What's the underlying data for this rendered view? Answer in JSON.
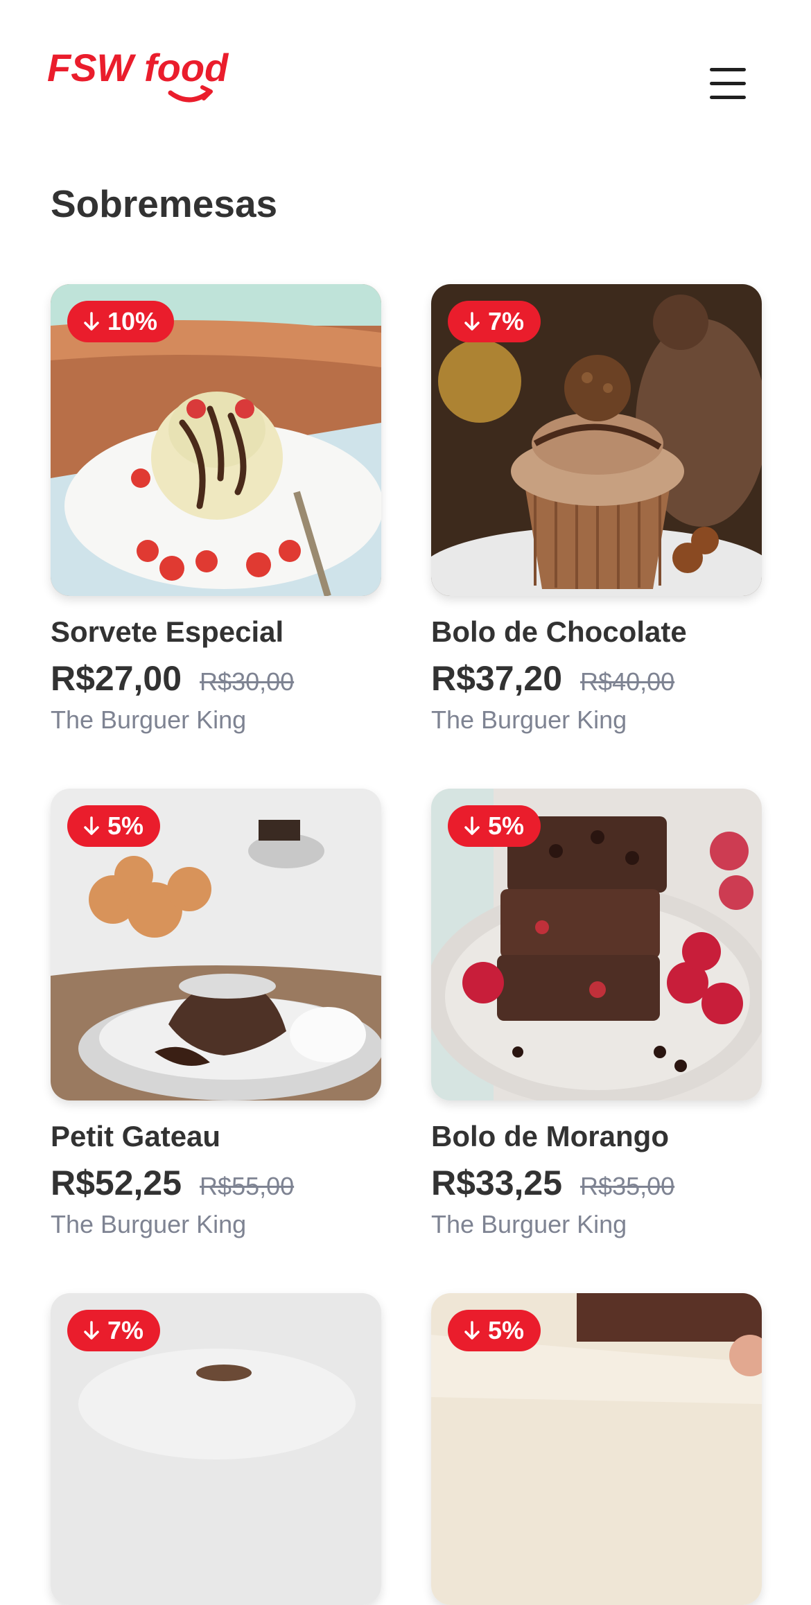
{
  "app": {
    "logo_text": "FSW food"
  },
  "page": {
    "title": "Sobremesas"
  },
  "colors": {
    "brand": "#EA1D2C",
    "text": "#323232",
    "muted": "#7E8392"
  },
  "icons": {
    "menu": "hamburger-menu-icon",
    "discount": "arrow-down-icon"
  },
  "products": [
    {
      "name": "Sorvete Especial",
      "price": "R$27,00",
      "old_price": "R$30,00",
      "discount": "10%",
      "restaurant": "The Burguer King",
      "image": "ice-cream-dessert-photo"
    },
    {
      "name": "Bolo de Chocolate",
      "price": "R$37,20",
      "old_price": "R$40,00",
      "discount": "7%",
      "restaurant": "The Burguer King",
      "image": "chocolate-cupcake-photo"
    },
    {
      "name": "Petit Gateau",
      "price": "R$52,25",
      "old_price": "R$55,00",
      "discount": "5%",
      "restaurant": "The Burguer King",
      "image": "petit-gateau-photo"
    },
    {
      "name": "Bolo de Morango",
      "price": "R$33,25",
      "old_price": "R$35,00",
      "discount": "5%",
      "restaurant": "The Burguer King",
      "image": "brownie-raspberry-photo"
    },
    {
      "discount": "7%",
      "image": "dessert-photo"
    },
    {
      "discount": "5%",
      "image": "dessert-photo"
    }
  ]
}
